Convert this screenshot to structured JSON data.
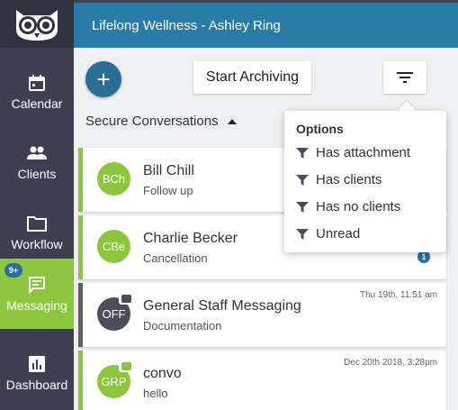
{
  "header": {
    "title": "Lifelong Wellness - Ashley Ring"
  },
  "sidebar": {
    "badge": "9+",
    "items": [
      {
        "label": "Calendar",
        "icon": "calendar-icon"
      },
      {
        "label": "Clients",
        "icon": "people-icon"
      },
      {
        "label": "Workflow",
        "icon": "folder-icon"
      },
      {
        "label": "Messaging",
        "icon": "message-icon",
        "active": true
      },
      {
        "label": "Dashboard",
        "icon": "bar-chart-icon"
      }
    ]
  },
  "toolbar": {
    "new_label": "+",
    "archive_label": "Start Archiving"
  },
  "section": {
    "title": "Secure Conversations"
  },
  "conversations": [
    {
      "initials": "BCh",
      "name": "Bill Chill",
      "subtitle": "Follow up",
      "time": ""
    },
    {
      "initials": "CBe",
      "name": "Charlie Becker",
      "subtitle": "Cancellation",
      "time": "",
      "unread": "1"
    },
    {
      "initials": "OFF",
      "name": "General Staff Messaging",
      "subtitle": "Documentation",
      "time": "Thu 19th, 11:51 am"
    },
    {
      "initials": "GRP",
      "name": "convo",
      "subtitle": "hello",
      "time": "Dec 20th 2018, 3:28pm"
    }
  ],
  "options": {
    "title": "Options",
    "items": [
      "Has attachment",
      "Has clients",
      "Has no clients",
      "Unread"
    ]
  },
  "colors": {
    "accent_green": "#8cc63f",
    "header_blue": "#2a7ca8",
    "sidebar_dark": "#3b4150"
  }
}
